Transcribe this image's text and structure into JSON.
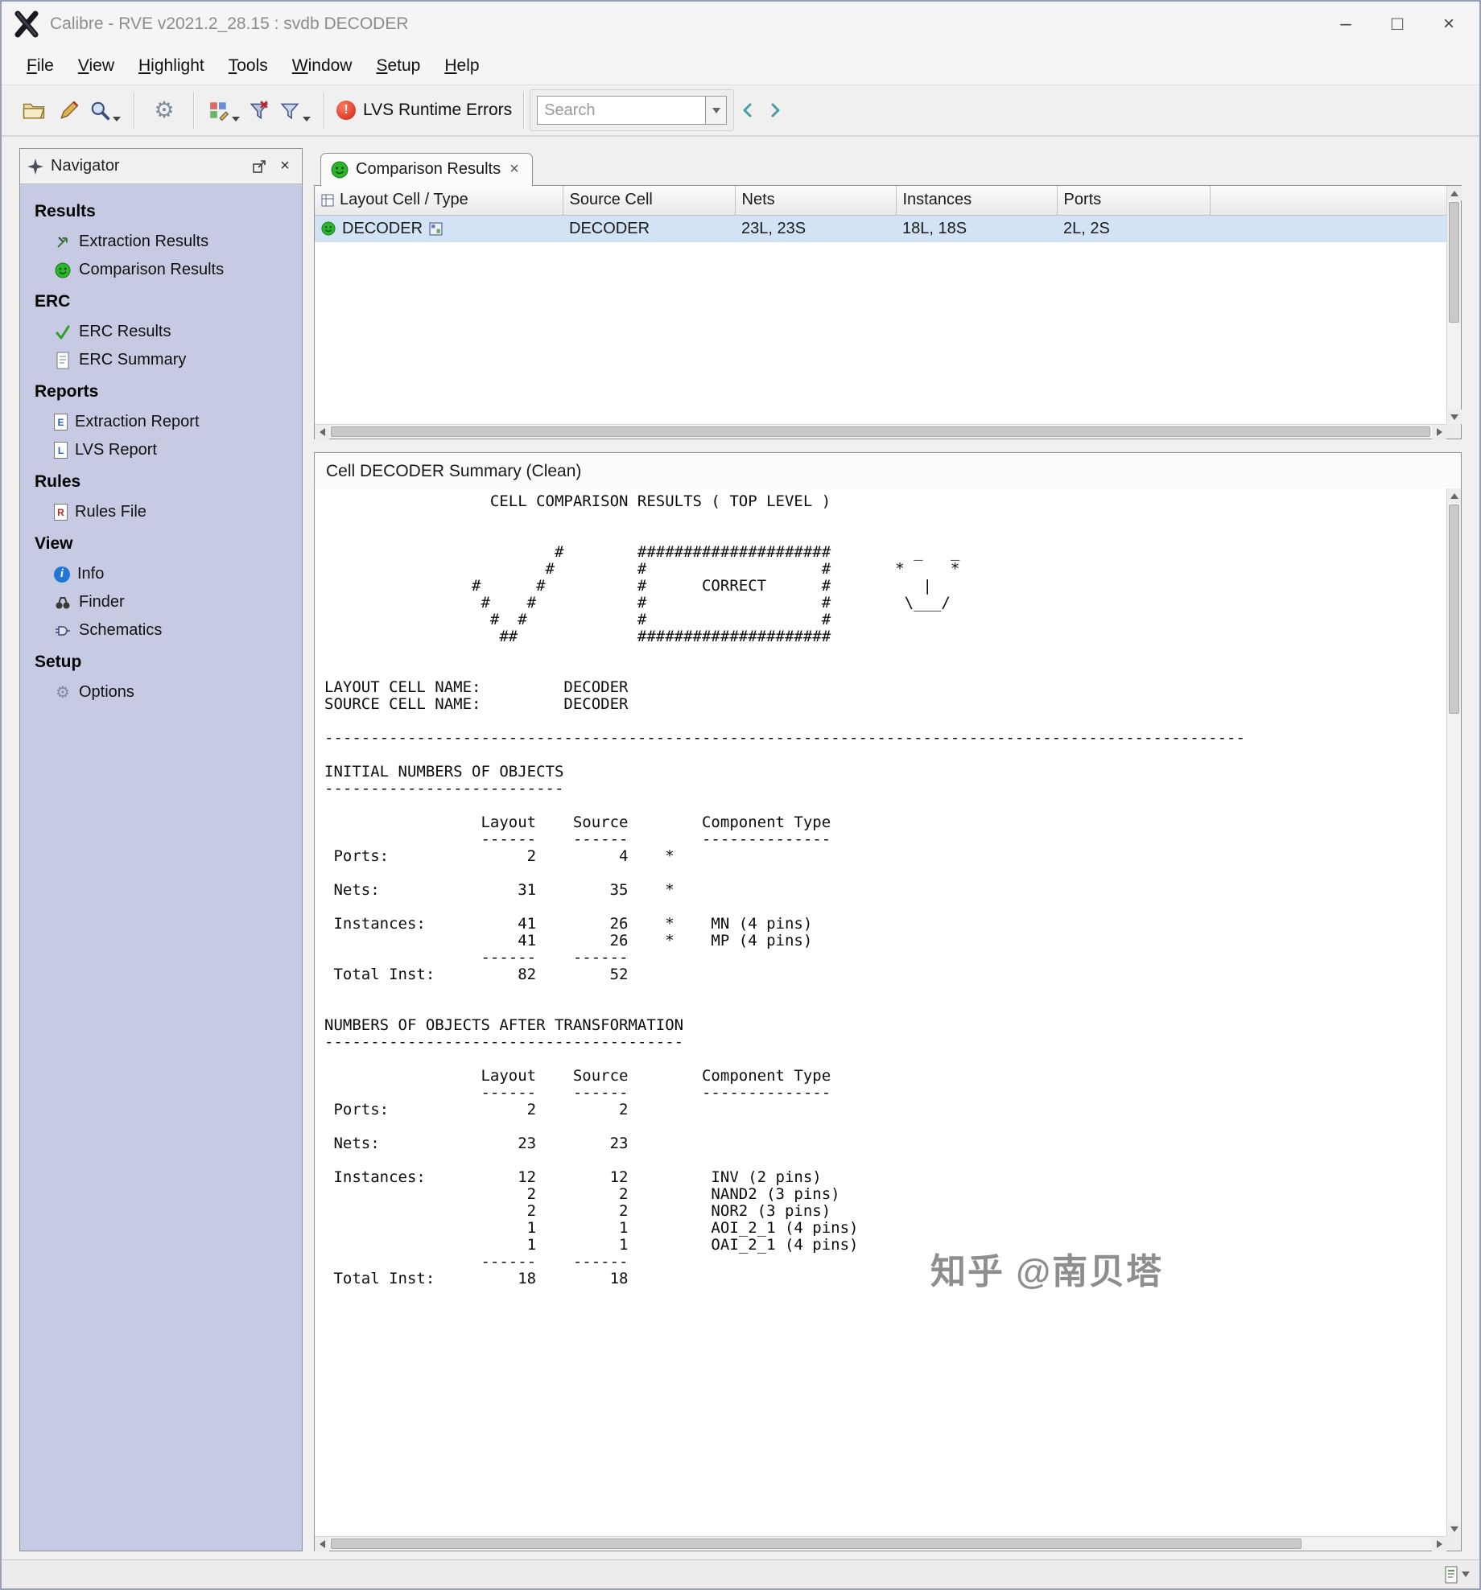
{
  "window": {
    "title": "Calibre - RVE v2021.2_28.15 : svdb DECODER",
    "controls": {
      "minimize": "–",
      "maximize": "□",
      "close": "×"
    }
  },
  "menubar": {
    "items": [
      "File",
      "View",
      "Highlight",
      "Tools",
      "Window",
      "Setup",
      "Help"
    ]
  },
  "toolbar": {
    "lvs_errors_label": "LVS Runtime Errors",
    "search_placeholder": "Search"
  },
  "navigator": {
    "title": "Navigator",
    "sections": [
      {
        "header": "Results",
        "items": [
          {
            "label": "Extraction Results"
          },
          {
            "label": "Comparison Results"
          }
        ]
      },
      {
        "header": "ERC",
        "items": [
          {
            "label": "ERC Results"
          },
          {
            "label": "ERC Summary"
          }
        ]
      },
      {
        "header": "Reports",
        "items": [
          {
            "label": "Extraction Report",
            "badge": "E"
          },
          {
            "label": "LVS Report",
            "badge": "L"
          }
        ]
      },
      {
        "header": "Rules",
        "items": [
          {
            "label": "Rules File",
            "badge": "R"
          }
        ]
      },
      {
        "header": "View",
        "items": [
          {
            "label": "Info",
            "badge": "i"
          },
          {
            "label": "Finder"
          },
          {
            "label": "Schematics"
          }
        ]
      },
      {
        "header": "Setup",
        "items": [
          {
            "label": "Options"
          }
        ]
      }
    ]
  },
  "tab": {
    "label": "Comparison Results"
  },
  "results_table": {
    "columns": [
      "Layout Cell / Type",
      "Source Cell",
      "Nets",
      "Instances",
      "Ports"
    ],
    "rows": [
      {
        "cell": "DECODER",
        "source": "DECODER",
        "nets": "23L, 23S",
        "instances": "18L, 18S",
        "ports": "2L, 2S"
      }
    ]
  },
  "summary": {
    "title": "Cell DECODER Summary (Clean)",
    "report": "                  CELL COMPARISON RESULTS ( TOP LEVEL )\n\n\n                         #        #####################         _   _\n                        #         #                   #       *     *\n                #      #          #      CORRECT      #          |\n                 #    #           #                   #        \\___/\n                  #  #            #                   #\n                   ##             #####################\n\n\nLAYOUT CELL NAME:         DECODER\nSOURCE CELL NAME:         DECODER\n\n----------------------------------------------------------------------------------------------------\n\nINITIAL NUMBERS OF OBJECTS\n--------------------------\n\n                 Layout    Source        Component Type\n                 ------    ------        --------------\n Ports:               2         4    *\n\n Nets:               31        35    *\n\n Instances:          41        26    *    MN (4 pins)\n                     41        26    *    MP (4 pins)\n                 ------    ------\n Total Inst:         82        52\n\n\nNUMBERS OF OBJECTS AFTER TRANSFORMATION\n---------------------------------------\n\n                 Layout    Source        Component Type\n                 ------    ------        --------------\n Ports:               2         2\n\n Nets:               23        23\n\n Instances:          12        12         INV (2 pins)\n                      2         2         NAND2 (3 pins)\n                      2         2         NOR2 (3 pins)\n                      1         1         AOI_2_1 (4 pins)\n                      1         1         OAI_2_1 (4 pins)\n                 ------    ------\n Total Inst:         18        18"
  },
  "watermark": {
    "text": "知乎 @南贝塔"
  }
}
